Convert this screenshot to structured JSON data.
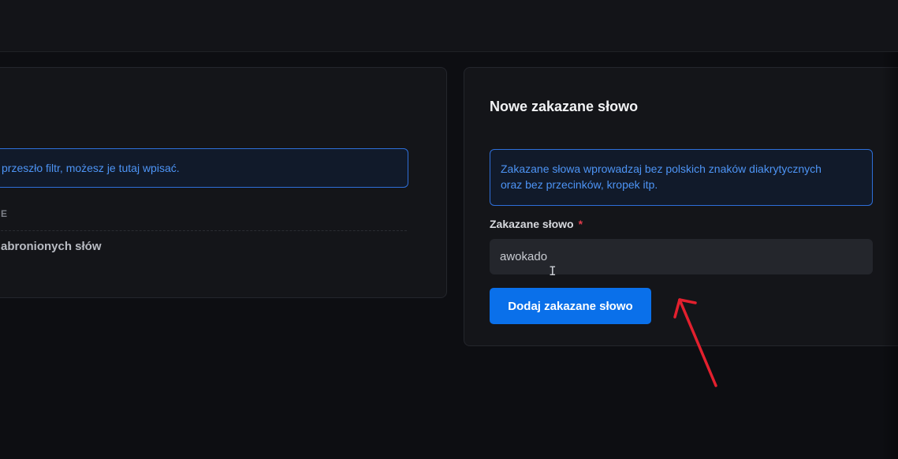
{
  "left_panel": {
    "info_text": "przeszło filtr, możesz je tutaj wpisać.",
    "column_header": "E",
    "empty_state": "abronionych słów"
  },
  "right_panel": {
    "title": "Nowe zakazane słowo",
    "info_text_line1": "Zakazane słowa wprowadzaj bez polskich znaków diakrytycznych",
    "info_text_line2": "oraz bez przecinków, kropek itp.",
    "field_label": "Zakazane słowo",
    "required_mark": "*",
    "input_value": "awokado",
    "submit_label": "Dodaj zakazane słowo"
  },
  "colors": {
    "accent": "#0a70ea",
    "info_border": "#2e6fd9",
    "annotation": "#e3202e"
  },
  "icons": {
    "text_cursor": "i-beam-cursor-icon",
    "annotation": "red-arrow-annotation"
  }
}
